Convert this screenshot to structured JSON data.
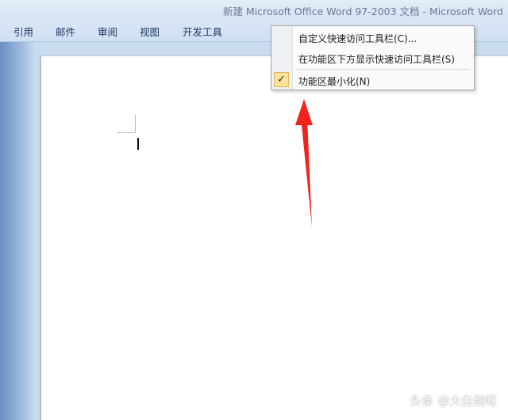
{
  "titlebar": {
    "title": "新建 Microsoft Office Word 97-2003 文档 - Microsoft Word"
  },
  "ribbon": {
    "tabs": [
      {
        "label": "引用"
      },
      {
        "label": "邮件"
      },
      {
        "label": "审阅"
      },
      {
        "label": "视图"
      },
      {
        "label": "开发工具"
      }
    ]
  },
  "context_menu": {
    "items": [
      {
        "label": "自定义快速访问工具栏(C)...",
        "checked": false
      },
      {
        "label": "在功能区下方显示快速访问工具栏(S)",
        "checked": false
      },
      {
        "label": "功能区最小化(N)",
        "checked": true
      }
    ],
    "check_glyph": "✓",
    "check_color": "#fde39a"
  },
  "annotation": {
    "arrow_color": "#f0231f",
    "icon": "red-arrow-icon"
  },
  "watermark": {
    "text": "头条 @大白熊呀"
  }
}
